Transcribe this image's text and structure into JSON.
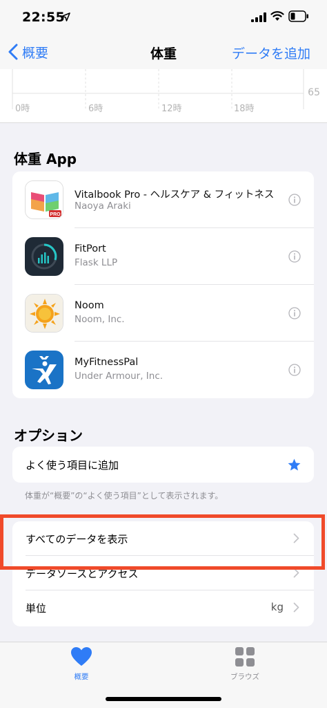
{
  "status": {
    "time": "22:55"
  },
  "nav": {
    "back_label": "概要",
    "title": "体重",
    "action_label": "データを追加"
  },
  "chart": {
    "ticks": [
      "0時",
      "6時",
      "12時",
      "18時"
    ],
    "y_label": "65"
  },
  "apps_section": {
    "title": "体重 App",
    "items": [
      {
        "name": "Vitalbook Pro - ヘルスケア & フィットネス",
        "developer": "Naoya Araki"
      },
      {
        "name": "FitPort",
        "developer": "Flask LLP"
      },
      {
        "name": "Noom",
        "developer": "Noom, Inc."
      },
      {
        "name": "MyFitnessPal",
        "developer": "Under Armour, Inc."
      }
    ]
  },
  "options_section": {
    "title": "オプション",
    "favorite_label": "よく使う項目に追加",
    "footnote": "体重が“概要”の“よく使う項目”として表示されます。",
    "rows": [
      {
        "label": "すべてのデータを表示"
      },
      {
        "label": "データソースとアクセス"
      },
      {
        "label": "単位",
        "value": "kg"
      }
    ]
  },
  "tabs": [
    {
      "label": "概要"
    },
    {
      "label": "ブラウズ"
    }
  ],
  "colors": {
    "accent": "#2f7cf6",
    "highlight": "#f04a2a"
  }
}
